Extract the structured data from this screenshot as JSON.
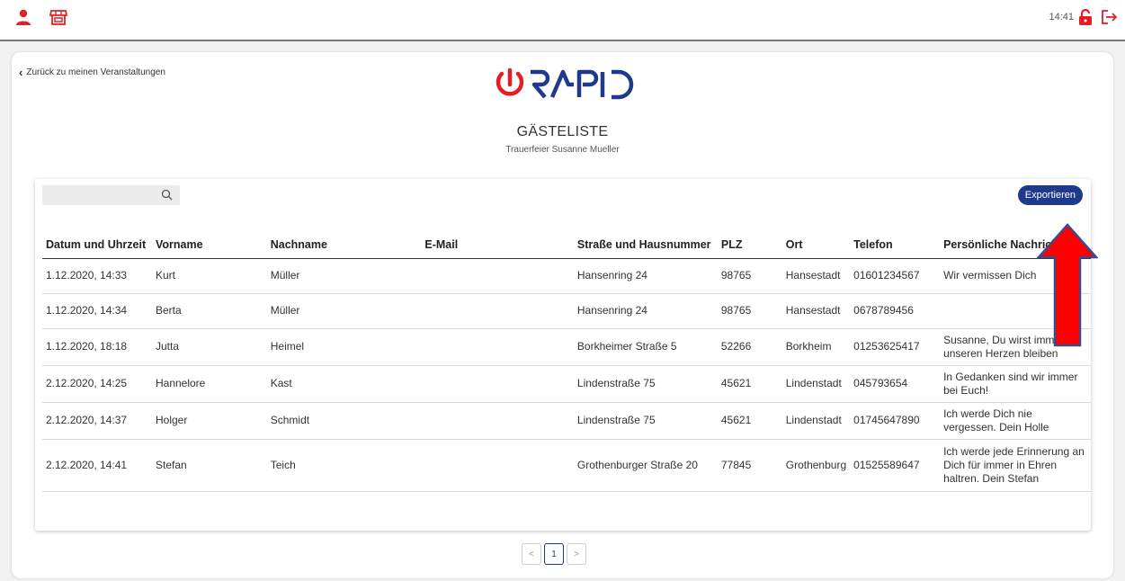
{
  "topbar": {
    "time": "14:41",
    "icons": {
      "user": "user-icon",
      "store": "store-icon",
      "lock": "lock-open-icon",
      "logout": "logout-icon"
    },
    "accent": "#e31e24"
  },
  "page": {
    "back_label": "Zurück zu meinen Veranstaltungen",
    "logo_text": "RAPID",
    "title": "GÄSTELISTE",
    "subtitle": "Trauerfeier Susanne Mueller"
  },
  "toolbar": {
    "search_value": "",
    "export_label": "Exportieren",
    "export_color": "#1f3a8a"
  },
  "table": {
    "headers": {
      "datetime": "Datum und Uhrzeit",
      "firstname": "Vorname",
      "lastname": "Nachname",
      "email": "E-Mail",
      "street": "Straße und Hausnummer",
      "zip": "PLZ",
      "city": "Ort",
      "phone": "Telefon",
      "message": "Persönliche Nachricht"
    },
    "rows": [
      {
        "datetime": "1.12.2020, 14:33",
        "firstname": "Kurt",
        "lastname": "Müller",
        "email": "",
        "street": "Hansenring 24",
        "zip": "98765",
        "city": "Hansestadt",
        "phone": "01601234567",
        "message": "Wir vermissen Dich"
      },
      {
        "datetime": "1.12.2020, 14:34",
        "firstname": "Berta",
        "lastname": "Müller",
        "email": "",
        "street": "Hansenring 24",
        "zip": "98765",
        "city": "Hansestadt",
        "phone": "0678789456",
        "message": ""
      },
      {
        "datetime": "1.12.2020, 18:18",
        "firstname": "Jutta",
        "lastname": "Heimel",
        "email": "",
        "street": "Borkheimer Straße 5",
        "zip": "52266",
        "city": "Borkheim",
        "phone": "01253625417",
        "message": "Susanne, Du wirst immer in unseren Herzen bleiben"
      },
      {
        "datetime": "2.12.2020, 14:25",
        "firstname": "Hannelore",
        "lastname": "Kast",
        "email": "",
        "street": "Lindenstraße 75",
        "zip": "45621",
        "city": "Lindenstadt",
        "phone": "045793654",
        "message": "In Gedanken sind wir immer bei Euch!"
      },
      {
        "datetime": "2.12.2020, 14:37",
        "firstname": "Holger",
        "lastname": "Schmidt",
        "email": "",
        "street": "Lindenstraße 75",
        "zip": "45621",
        "city": "Lindenstadt",
        "phone": "01745647890",
        "message": "Ich werde Dich nie vergessen. Dein Holle"
      },
      {
        "datetime": "2.12.2020, 14:41",
        "firstname": "Stefan",
        "lastname": "Teich",
        "email": "",
        "street": "Grothenburger Straße 20",
        "zip": "77845",
        "city": "Grothenburg",
        "phone": "01525589647",
        "message": "Ich werde jede Erinnerung an Dich für immer in Ehren haltren. Dein Stefan"
      }
    ]
  },
  "pagination": {
    "prev": "<",
    "current": "1",
    "next": ">"
  },
  "annotation": {
    "arrow_color": "#ff0000",
    "arrow_border": "#3a4a8a"
  }
}
